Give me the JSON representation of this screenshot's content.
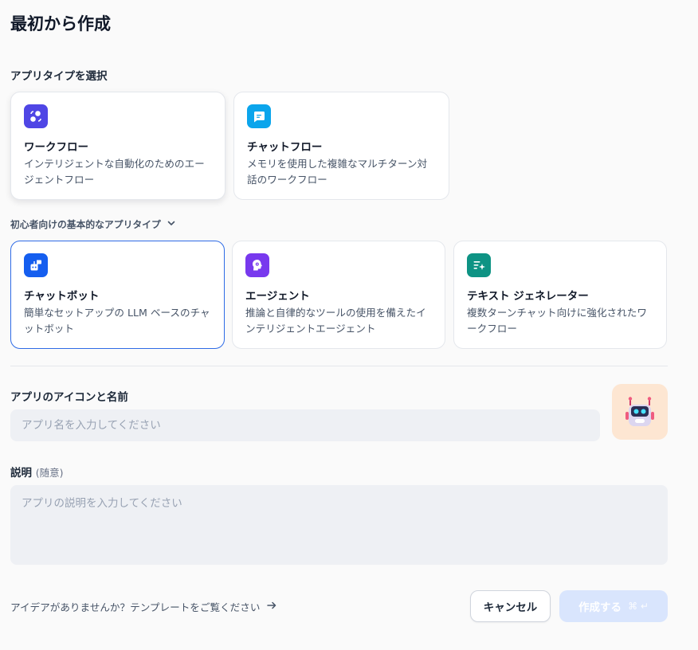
{
  "page": {
    "title": "最初から作成"
  },
  "app_type_section": {
    "label": "アプリタイプを選択",
    "primary_cards": [
      {
        "title": "ワークフロー",
        "description": "インテリジェントな自動化のためのエージェントフロー",
        "icon": "workflow-icon",
        "icon_color": "#4f46e5"
      },
      {
        "title": "チャットフロー",
        "description": "メモリを使用した複雑なマルチターン対話のワークフロー",
        "icon": "chatflow-icon",
        "icon_color": "#0ba5ec"
      }
    ],
    "beginner_toggle_label": "初心者向けの基本的なアプリタイプ",
    "beginner_cards": [
      {
        "title": "チャットボット",
        "description": "簡単なセットアップの LLM ベースのチャットボット",
        "icon": "chatbot-icon",
        "icon_color": "#155eef",
        "selected": true
      },
      {
        "title": "エージェント",
        "description": "推論と自律的なツールの使用を備えたインテリジェントエージェント",
        "icon": "agent-icon",
        "icon_color": "#7839ee"
      },
      {
        "title": "テキスト ジェネレーター",
        "description": "複数ターンチャット向けに強化されたワークフロー",
        "icon": "text-generator-icon",
        "icon_color": "#0e9384"
      }
    ]
  },
  "name_section": {
    "label": "アプリのアイコンと名前",
    "placeholder": "アプリ名を入力してください",
    "icon": "robot-emoji"
  },
  "description_section": {
    "label": "説明",
    "optional_label": "(随意)",
    "placeholder": "アプリの説明を入力してください"
  },
  "footer": {
    "template_link": "アイデアがありませんか？テンプレートをご覧ください",
    "cancel_label": "キャンセル",
    "create_label": "作成する",
    "create_shortcut": "⌘ ↵"
  },
  "colors": {
    "selected_border": "#2e6be6",
    "create_button_bg": "#d9e5fd"
  }
}
